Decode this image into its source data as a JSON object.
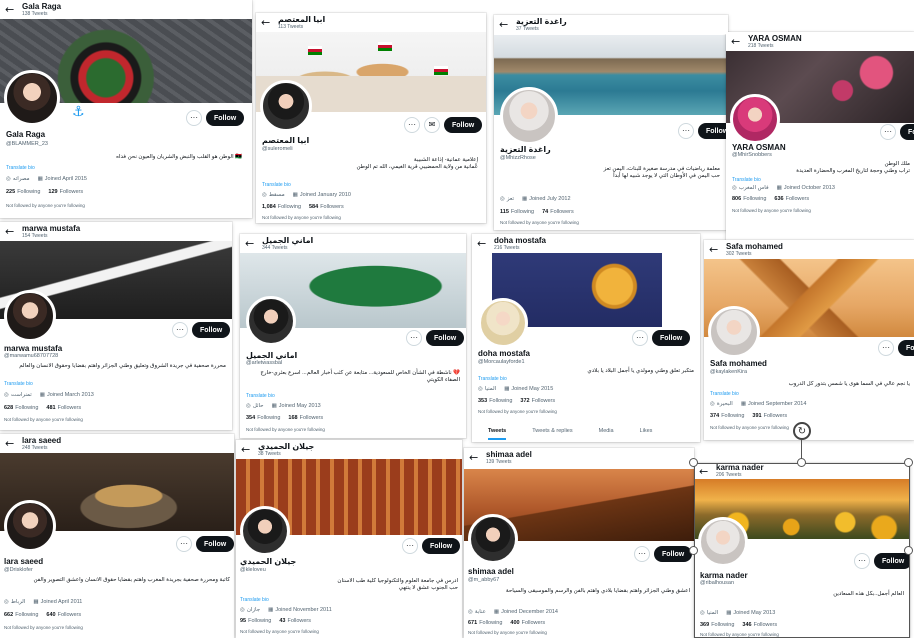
{
  "ui": {
    "back_glyph": "←",
    "more_glyph": "···",
    "follow_label": "Follow",
    "mail_glyph": "✉",
    "bell_glyph": "🔔"
  },
  "icons": {
    "location": "location-pin-icon",
    "calendar": "calendar-icon"
  },
  "colors": {
    "link": "#1d9bf0",
    "text": "#0f1419",
    "muted": "#536471",
    "button": "#0f1419"
  },
  "profiles": [
    {
      "header_name": "Gala Raga",
      "header_tweets": "138 Tweets",
      "name": "Gala Raga",
      "handle": "@BLAMMER_23",
      "bio": "🇱🇾 الوطن هو القلب والنبض والشريان والعيون نحن فداه",
      "translate": "Translate bio",
      "location": "مصراته",
      "joined": "Joined April 2015",
      "following": "225",
      "following_label": "Following",
      "followers": "129",
      "followers_label": "Followers",
      "not_followed": "Not followed by anyone you're following"
    },
    {
      "header_name": "ابيا المعتصم",
      "header_tweets": "113 Tweets",
      "name": "ابيا المعتصم",
      "handle": "@suleromeli",
      "bio": "إعلامية عمانية- إذاعة الشبيبة\nعُمانية من ولاية الحمضيبي قرية الغيمي، الله تم الوطن",
      "translate": "Translate bio",
      "location": "مسقط",
      "joined": "Joined January 2010",
      "following": "1,084",
      "following_label": "Following",
      "followers": "584",
      "followers_label": "Followers",
      "not_followed": "Not followed by anyone you're following"
    },
    {
      "header_name": "راغدة التعزية",
      "header_tweets": "37 Tweets",
      "name": "راغدة التعزية",
      "handle": "@MhizzRhose",
      "bio": "معلمة رياضيات في مدرسة صغيرة للبنات، اليمن تعز\nحب اليمن في الأوطان التي لا يوجد شبيه لها أبداً",
      "translate": "Translate bio",
      "location": "تعز",
      "joined": "Joined July 2012",
      "following": "115",
      "following_label": "Following",
      "followers": "74",
      "followers_label": "Followers",
      "not_followed": "Not followed by anyone you're following"
    },
    {
      "header_name": "YARA OSMAN",
      "header_tweets": "218 Tweets",
      "name": "YARA OSMAN",
      "handle": "@MhirSnobbers",
      "bio": "ملك الوطن\nتراب وطني وحجة لتاريخ المغرب والحضارة العديدة",
      "translate": "Translate bio",
      "location": "فاس المغرب",
      "joined": "Joined October 2013",
      "following": "806",
      "following_label": "Following",
      "followers": "636",
      "followers_label": "Followers",
      "not_followed": "Not followed by anyone you're following"
    },
    {
      "header_name": "marwa mustafa",
      "header_tweets": "154 Tweets",
      "name": "marwa mustafa",
      "handle": "@marwamu68707728",
      "bio": "محررة صحفية في جريدة الشروق وتعليق وطني الجزائر واهتم بقضايا وحقوق الانسان والعالم",
      "translate": "Translate bio",
      "location": "تمنراست",
      "joined": "Joined March 2013",
      "following": "628",
      "following_label": "Following",
      "followers": "481",
      "followers_label": "Followers",
      "not_followed": "Not followed by anyone you're following"
    },
    {
      "header_name": "اماني الجميل",
      "header_tweets": "344 Tweets",
      "name": "اماني الجميل",
      "handle": "@arletwassbal",
      "bio": "💔 ناشطة في الشأن الخاص للسعودية... متابعة عن كثب أخبار العالم... اسرع بعثري-خارج الصفاء الكويتي",
      "translate": "Translate bio",
      "location": "حائل",
      "joined": "Joined May 2013",
      "following": "354",
      "following_label": "Following",
      "followers": "168",
      "followers_label": "Followers",
      "not_followed": "Not followed by anyone you're following"
    },
    {
      "header_name": "doha mostafa",
      "header_tweets": "216 Tweets",
      "name": "doha mostafa",
      "handle": "@Morcaulayforde1",
      "bio": "متكبر تعلق وطني ومولدي يا أجمل البلاد يا بلادي",
      "translate": "Translate bio",
      "location": "المنيا",
      "joined": "Joined May 2015",
      "following": "353",
      "following_label": "Following",
      "followers": "372",
      "followers_label": "Followers",
      "not_followed": "Not followed by anyone you're following",
      "tabs": [
        "Tweets",
        "Tweets & replies",
        "Media",
        "Likes"
      ]
    },
    {
      "header_name": "Safa mohamed",
      "header_tweets": "302 Tweets",
      "name": "Safa mohamed",
      "handle": "@kaylakenKira",
      "bio": "يا نجم عالي في السما هوى يا شمس بتدور كل الدروب",
      "translate": "Translate bio",
      "location": "البحيرة",
      "joined": "Joined September 2014",
      "following": "374",
      "following_label": "Following",
      "followers": "391",
      "followers_label": "Followers",
      "not_followed": "Not followed by anyone you're following"
    },
    {
      "header_name": "lara saeed",
      "header_tweets": "248 Tweets",
      "name": "lara saeed",
      "handle": "@Drisklofer",
      "bio": "كاتبة ومحررة صحفية بجريدة المغرب واهتم بقضايا حقوق الانسان واعشق التصوير والفن",
      "translate": "Translate bio",
      "location": "الرباط",
      "joined": "Joined April 2011",
      "following": "662",
      "following_label": "Following",
      "followers": "640",
      "followers_label": "Followers",
      "not_followed": "Not followed by anyone you're following"
    },
    {
      "header_name": "جيلان الحميدي",
      "header_tweets": "38 Tweets",
      "name": "جيلان الحميدي",
      "handle": "@kleloveu",
      "bio": "ادرس في جامعة العلوم والتكنولوجيا كلية طب الاسنان\nحب الجنوب عشق لا ينتهي",
      "translate": "Translate bio",
      "location": "جازان",
      "joined": "Joined November 2011",
      "following": "95",
      "following_label": "Following",
      "followers": "43",
      "followers_label": "Followers",
      "not_followed": "Not followed by anyone you're following"
    },
    {
      "header_name": "shimaa adel",
      "header_tweets": "139 Tweets",
      "name": "shimaa adel",
      "handle": "@m_abby67",
      "bio": "اعشق وطني الجزائر واهتم بقضايا بلادي واهتم بالفن والرسم والموسيقى والسياحة",
      "translate": "Translate bio",
      "location": "عنابة",
      "joined": "Joined December 2014",
      "following": "671",
      "following_label": "Following",
      "followers": "400",
      "followers_label": "Followers",
      "not_followed": "Not followed by anyone you're following"
    },
    {
      "header_name": "karma nader",
      "header_tweets": "206 Tweets",
      "name": "karma nader",
      "handle": "@ribalhousan",
      "bio": "العالم أجمل..بكل هذه السعادين",
      "translate": "Translate bio",
      "location": "المنيا",
      "joined": "Joined May 2013",
      "following": "369",
      "following_label": "Following",
      "followers": "346",
      "followers_label": "Followers",
      "not_followed": "Not followed by anyone you're following"
    }
  ]
}
